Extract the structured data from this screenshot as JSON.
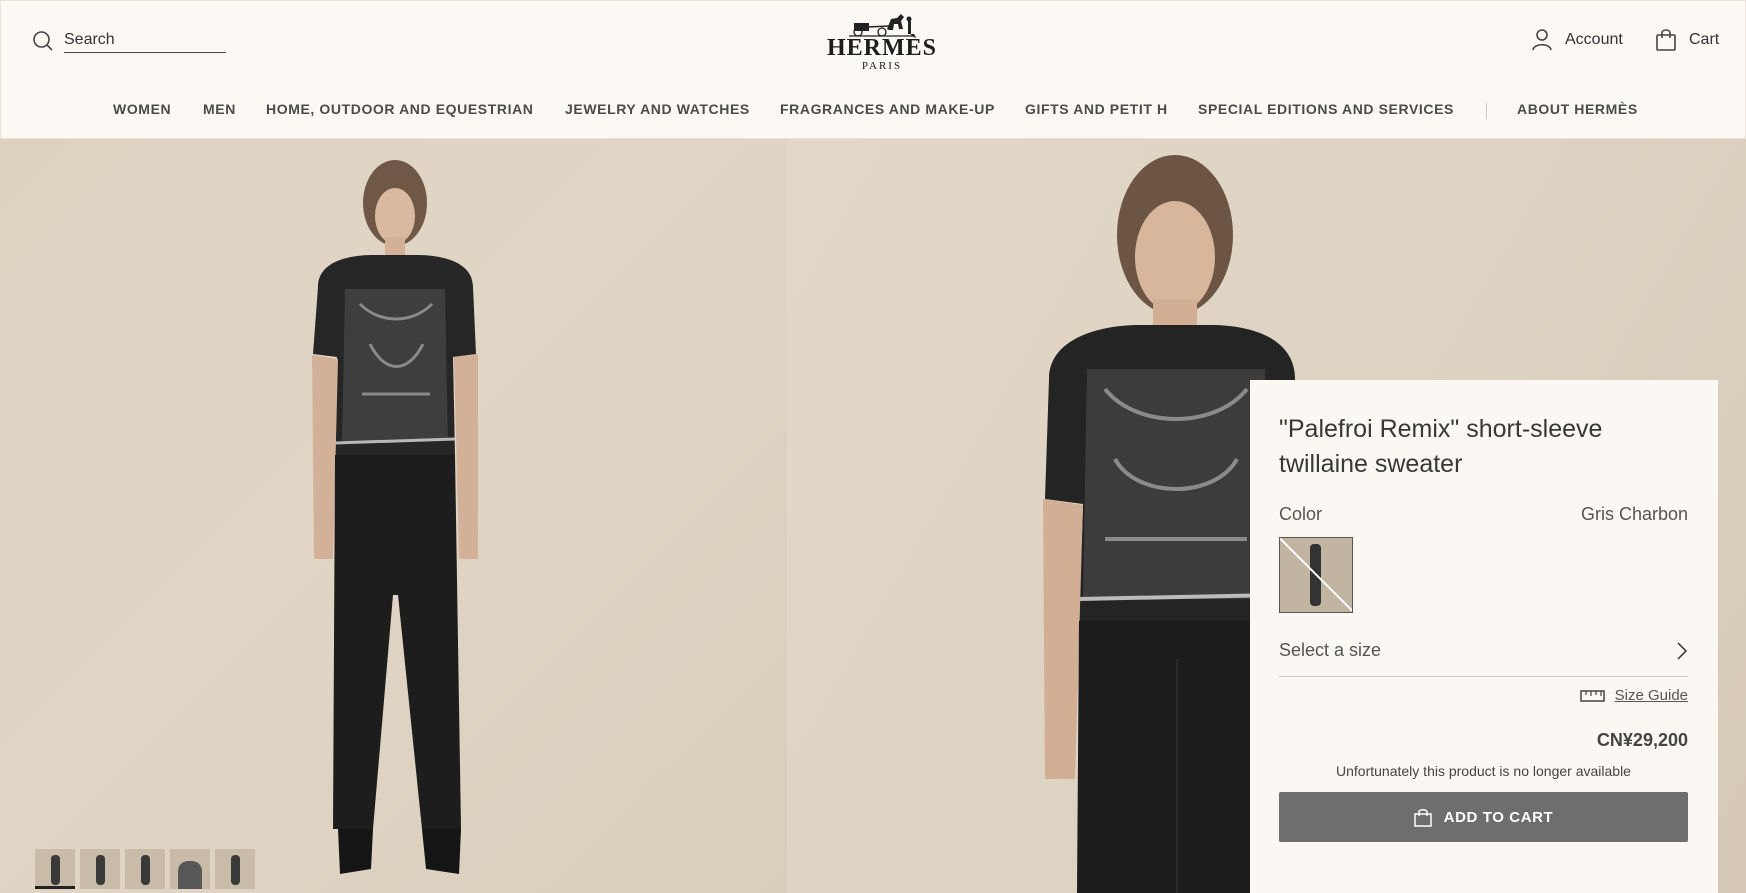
{
  "header": {
    "search_placeholder": "Search",
    "brand": "HERMÈS",
    "brand_city": "PARIS",
    "account_label": "Account",
    "cart_label": "Cart"
  },
  "nav": {
    "items": [
      "WOMEN",
      "MEN",
      "HOME, OUTDOOR AND EQUESTRIAN",
      "JEWELRY AND WATCHES",
      "FRAGRANCES AND MAKE-UP",
      "GIFTS AND PETIT H",
      "SPECIAL EDITIONS AND SERVICES",
      "ABOUT HERMÈS"
    ]
  },
  "product": {
    "title": "\"Palefroi Remix\" short-sleeve twillaine sweater",
    "color_label": "Color",
    "color_value": "Gris Charbon",
    "size_prompt": "Select a size",
    "size_guide": "Size Guide",
    "price": "CN¥29,200",
    "availability": "Unfortunately this product is no longer available",
    "add_to_cart": "ADD TO CART"
  },
  "gallery": {
    "thumbnail_count": 5,
    "active_thumbnail": 1
  },
  "icons": {
    "search": "search-icon",
    "account": "user-icon",
    "cart": "shopping-bag-icon",
    "size_next": "chevron-right-icon",
    "size_guide": "ruler-icon",
    "add_to_cart": "shopping-bag-icon"
  },
  "colors": {
    "background": "#fcf8f3",
    "text": "#444444",
    "button": "#6e6e6e"
  }
}
